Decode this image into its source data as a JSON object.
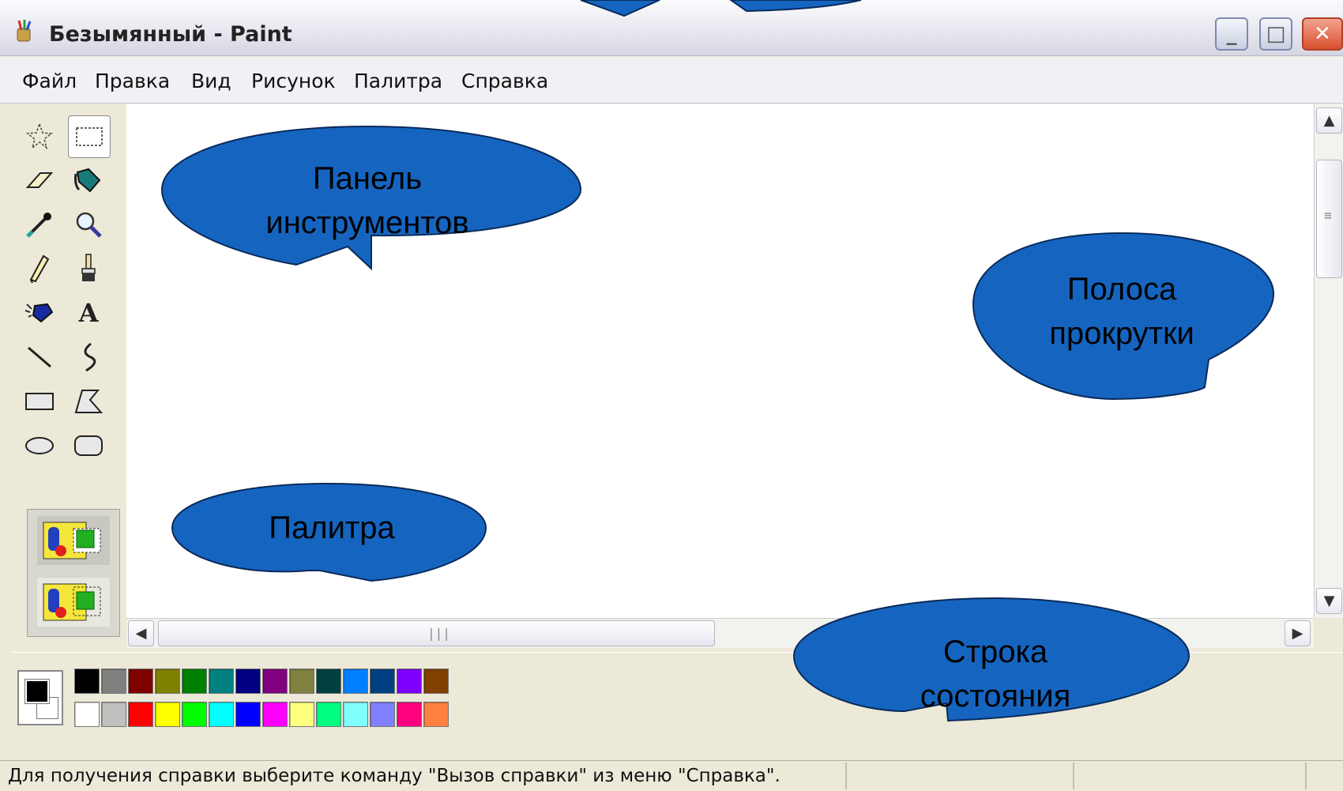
{
  "window": {
    "title": "Безымянный - Paint",
    "controls": {
      "minimize": "_",
      "maximize": "□",
      "close": "✕"
    }
  },
  "menu": {
    "items": [
      "Файл",
      "Правка",
      "Вид",
      "Рисунок",
      "Палитра",
      "Справка"
    ]
  },
  "toolbox": {
    "tools": [
      {
        "name": "free-form-select",
        "icon": "star-select-icon"
      },
      {
        "name": "rect-select",
        "icon": "dashed-rect-icon",
        "selected": true
      },
      {
        "name": "eraser",
        "icon": "eraser-icon"
      },
      {
        "name": "fill",
        "icon": "bucket-icon"
      },
      {
        "name": "pick-color",
        "icon": "eyedropper-icon"
      },
      {
        "name": "magnifier",
        "icon": "magnifier-icon"
      },
      {
        "name": "pencil",
        "icon": "pencil-icon"
      },
      {
        "name": "brush",
        "icon": "brush-icon"
      },
      {
        "name": "airbrush",
        "icon": "airbrush-icon"
      },
      {
        "name": "text",
        "icon": "text-icon",
        "glyph": "A"
      },
      {
        "name": "line",
        "icon": "line-icon"
      },
      {
        "name": "curve",
        "icon": "curve-icon"
      },
      {
        "name": "rectangle",
        "icon": "rectangle-icon"
      },
      {
        "name": "polygon",
        "icon": "polygon-icon"
      },
      {
        "name": "ellipse",
        "icon": "ellipse-icon"
      },
      {
        "name": "rounded-rectangle",
        "icon": "rounded-rect-icon"
      }
    ]
  },
  "palette": {
    "foreground": "#000000",
    "background": "#ffffff",
    "row1": [
      "#000000",
      "#808080",
      "#800000",
      "#808000",
      "#008000",
      "#008080",
      "#000080",
      "#800080",
      "#808040",
      "#004040",
      "#0080ff",
      "#004080",
      "#8000ff",
      "#804000"
    ],
    "row2": [
      "#ffffff",
      "#c0c0c0",
      "#ff0000",
      "#ffff00",
      "#00ff00",
      "#00ffff",
      "#0000ff",
      "#ff00ff",
      "#ffff80",
      "#00ff80",
      "#80ffff",
      "#8080ff",
      "#ff0080",
      "#ff8040"
    ]
  },
  "status": {
    "text": "Для получения справки выберите команду \"Вызов справки\" из меню \"Справка\"."
  },
  "scroll": {
    "grip": "|||",
    "grip_v": "≡"
  },
  "callouts": {
    "toolbar": [
      "Панель",
      "инструментов"
    ],
    "scrollbar": [
      "Полоса",
      "прокрутки"
    ],
    "palette": "Палитра",
    "statusbar": [
      "Строка",
      "состояния"
    ]
  },
  "colors": {
    "callout_fill": "#1565C0",
    "callout_stroke": "#0a2a5a"
  }
}
